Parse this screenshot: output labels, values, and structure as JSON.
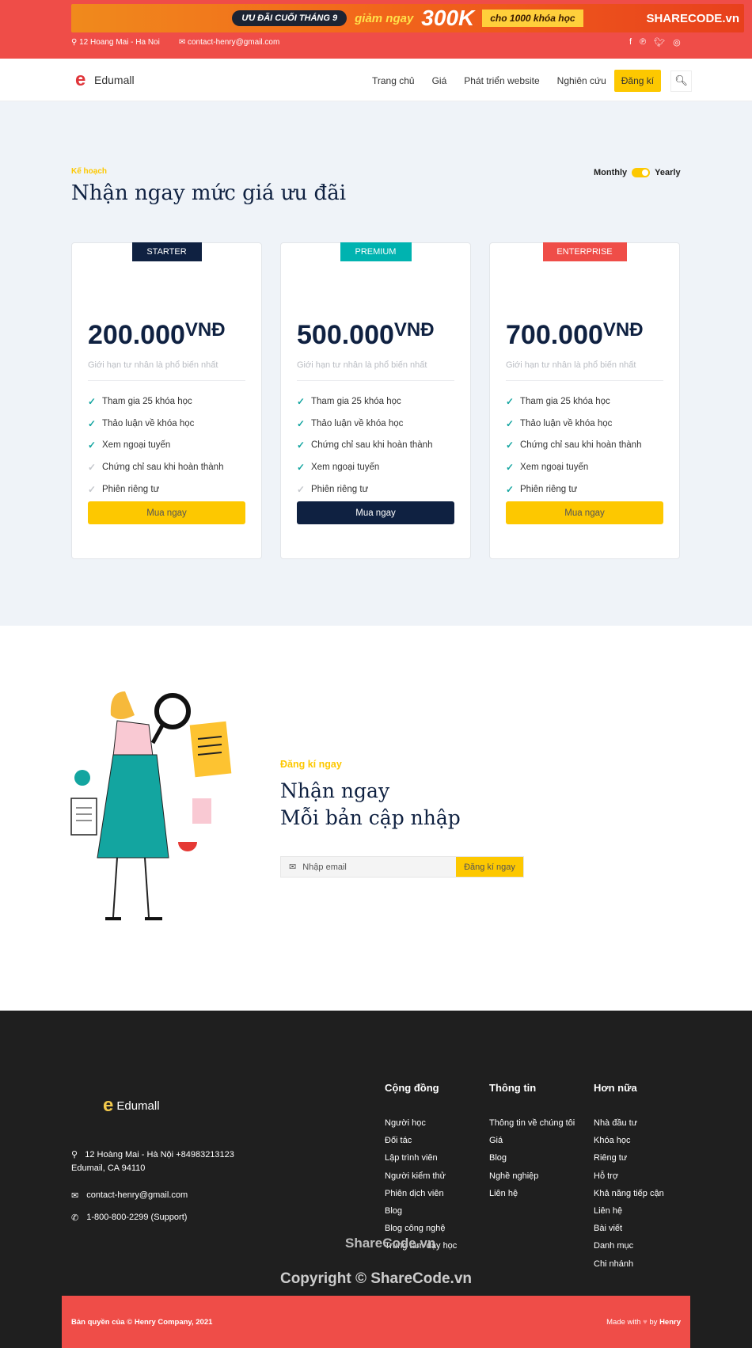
{
  "banner": {
    "pill": "ƯU ĐÃI CUỐI THÁNG 9",
    "lead": "giảm ngay",
    "amount": "300K",
    "box": "cho 1000 khóa học",
    "brand": "SHARECODE.vn"
  },
  "topbar": {
    "address": "12 Hoang Mai - Ha Noi",
    "email": "contact-henry@gmail.com",
    "social_icons": [
      "facebook-icon",
      "pinterest-icon",
      "twitter-icon",
      "instagram-icon"
    ]
  },
  "nav": {
    "logo": "Edumall",
    "items": [
      "Trang chủ",
      "Giá",
      "Phát triển website",
      "Nghiên cứu"
    ],
    "signup": "Đăng kí"
  },
  "pricing": {
    "eyebrow": "Kế hoạch",
    "title": "Nhận ngay mức giá ưu đãi",
    "toggle": {
      "left": "Monthly",
      "right": "Yearly"
    },
    "plans": [
      {
        "name": "STARTER",
        "color": "#0f2141",
        "price": "200.000",
        "currency": "VNĐ",
        "desc": "Giới hạn tư nhân là phổ biến nhất",
        "button": "Mua ngay",
        "button_style": "yellow",
        "features": [
          {
            "t": "Tham gia 25 khóa học",
            "on": true
          },
          {
            "t": "Thảo luận về khóa học",
            "on": true
          },
          {
            "t": "Xem ngoại tuyến",
            "on": true
          },
          {
            "t": "Chứng chỉ sau khi hoàn thành",
            "on": false
          },
          {
            "t": "Phiên riêng tư",
            "on": false
          }
        ]
      },
      {
        "name": "PREMIUM",
        "color": "#00b3b0",
        "price": "500.000",
        "currency": "VNĐ",
        "desc": "Giới hạn tư nhân là phổ biến nhất",
        "button": "Mua ngay",
        "button_style": "dark",
        "features": [
          {
            "t": "Tham gia 25 khóa học",
            "on": true
          },
          {
            "t": "Thảo luận về khóa học",
            "on": true
          },
          {
            "t": "Chứng chỉ sau khi hoàn thành",
            "on": true
          },
          {
            "t": "Xem ngoại tuyến",
            "on": true
          },
          {
            "t": "Phiên riêng tư",
            "on": false
          }
        ]
      },
      {
        "name": "ENTERPRISE",
        "color": "#ef4d48",
        "price": "700.000",
        "currency": "VNĐ",
        "desc": "Giới hạn tư nhân là phổ biến nhất",
        "button": "Mua ngay",
        "button_style": "yellow",
        "features": [
          {
            "t": "Tham gia 25 khóa học",
            "on": true
          },
          {
            "t": "Thảo luận về khóa học",
            "on": true
          },
          {
            "t": "Chứng chỉ sau khi hoàn thành",
            "on": true
          },
          {
            "t": "Xem ngoại tuyến",
            "on": true
          },
          {
            "t": "Phiên riêng tư",
            "on": true
          }
        ]
      }
    ]
  },
  "newsletter": {
    "eyebrow": "Đăng kí ngay",
    "title1": "Nhận ngay",
    "title2": "Mỗi bản cập nhập",
    "placeholder": "Nhập email",
    "button": "Đăng kí ngay"
  },
  "footer": {
    "logo": "Edumall",
    "address": "12 Hoàng Mai - Hà Nội  +84983213123",
    "address2": "Edumail, CA 94110",
    "email": "contact-henry@gmail.com",
    "phone": "1-800-800-2299 (Support)",
    "columns": [
      {
        "title": "Cộng đồng",
        "links": [
          "Người học",
          "Đối tác",
          "Lập trình viên",
          "Người kiểm thử",
          "Phiên dịch viên",
          "Blog",
          "Blog công nghệ",
          "Trung tâm dạy học"
        ]
      },
      {
        "title": "Thông tin",
        "links": [
          "Thông tin về chúng tôi",
          "Giá",
          "Blog",
          "Nghề nghiệp",
          "Liên hệ"
        ]
      },
      {
        "title": "Hơn nữa",
        "links": [
          "Nhà đầu tư",
          "Khóa học",
          "Riêng tư",
          "Hỗ trợ",
          "Khả năng tiếp cận",
          "Liên hệ",
          "Bài viết",
          "Danh mục",
          "Chi nhánh"
        ]
      }
    ],
    "copyright": "Bản quyền của © Henry Company, 2021",
    "made_with": "Made with",
    "by": "by",
    "author": "Henry"
  },
  "watermark": {
    "small": "ShareCode.vn",
    "big": "Copyright © ShareCode.vn"
  }
}
